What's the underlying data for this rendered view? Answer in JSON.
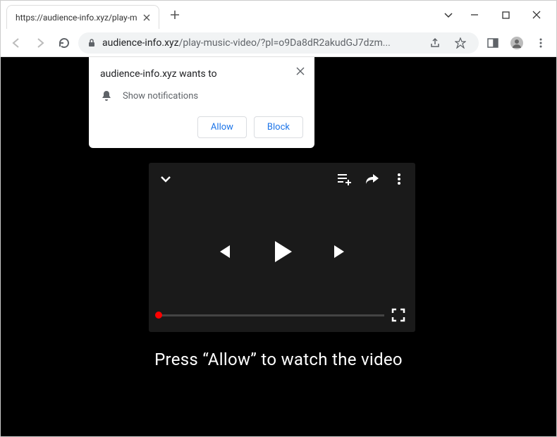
{
  "window": {
    "tab_title": "https://audience-info.xyz/play-m"
  },
  "toolbar": {
    "url_domain": "audience-info.xyz",
    "url_path": "/play-music-video/?pl=o9Da8dR2akudGJ7dzm..."
  },
  "prompt": {
    "title": "audience-info.xyz wants to",
    "body": "Show notifications",
    "allow_label": "Allow",
    "block_label": "Block"
  },
  "page": {
    "caption": "Press “Allow” to watch the video"
  }
}
